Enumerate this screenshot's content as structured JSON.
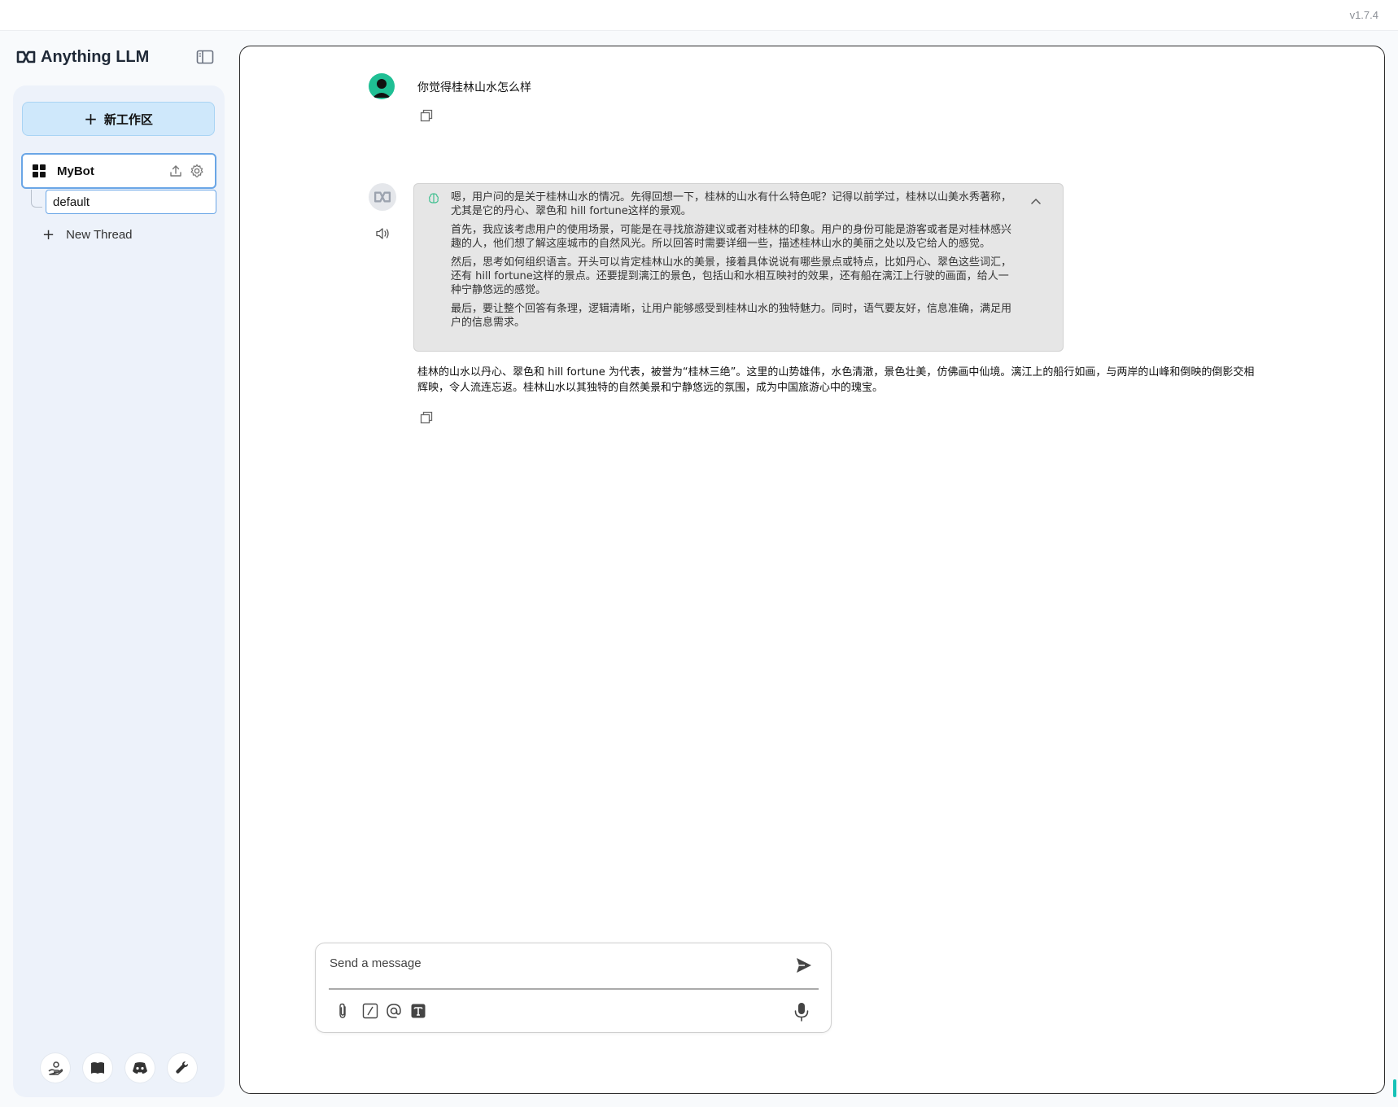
{
  "app": {
    "version": "v1.7.4",
    "brand": "Anything LLM"
  },
  "sidebar": {
    "new_workspace_label": "新工作区",
    "workspace": {
      "name": "MyBot"
    },
    "threads": [
      {
        "label": "default"
      }
    ],
    "new_thread_label": "New Thread",
    "footer_icons": [
      "support-icon",
      "docs-book-icon",
      "discord-icon",
      "settings-wrench-icon"
    ]
  },
  "chat": {
    "user_message": "你觉得桂林山水怎么样",
    "thinking": [
      "嗯，用户问的是关于桂林山水的情况。先得回想一下，桂林的山水有什么特色呢？记得以前学过，桂林以山美水秀著称，尤其是它的丹心、翠色和 hill fortune这样的景观。",
      "首先，我应该考虑用户的使用场景，可能是在寻找旅游建议或者对桂林的印象。用户的身份可能是游客或者是对桂林感兴趣的人，他们想了解这座城市的自然风光。所以回答时需要详细一些，描述桂林山水的美丽之处以及它给人的感觉。",
      "然后，思考如何组织语言。开头可以肯定桂林山水的美景，接着具体说说有哪些景点或特点，比如丹心、翠色这些词汇，还有 hill fortune这样的景点。还要提到漓江的景色，包括山和水相互映衬的效果，还有船在漓江上行驶的画面，给人一种宁静悠远的感觉。",
      "最后，要让整个回答有条理，逻辑清晰，让用户能够感受到桂林山水的独特魅力。同时，语气要友好，信息准确，满足用户的信息需求。"
    ],
    "answer": "桂林的山水以丹心、翠色和 hill fortune 为代表，被誉为“桂林三绝”。这里的山势雄伟，水色清澈，景色壮美，仿佛画中仙境。漓江上的船行如画，与两岸的山峰和倒映的倒影交相辉映，令人流连忘返。桂林山水以其独特的自然美景和宁静悠远的氛围，成为中国旅游心中的瑰宝。"
  },
  "composer": {
    "placeholder": "Send a message"
  },
  "colors": {
    "new_workspace_bg": "#cfe8fb",
    "active_border": "#6aa6e6",
    "user_avatar": "#1fbf94",
    "thinking_bg": "#e6e6e6"
  }
}
